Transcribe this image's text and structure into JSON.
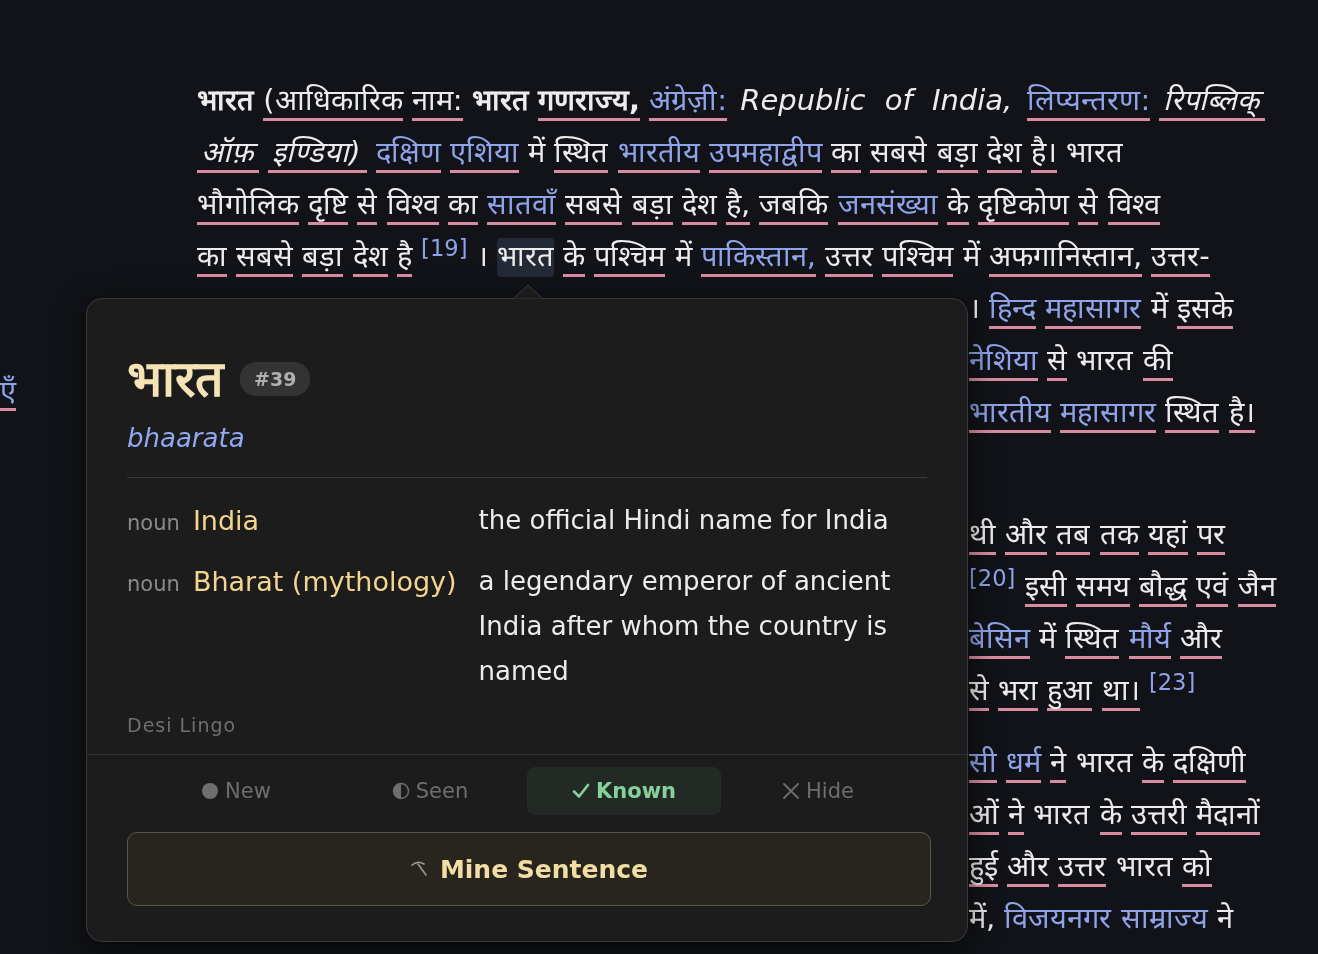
{
  "sidebar_fragment": {
    "text": "एँ",
    "underlined": true
  },
  "article": {
    "paragraphs": [
      {
        "lines": [
          {
            "covered_by_popup": false,
            "tokens": [
              {
                "text": "भारत",
                "kind": "bold",
                "underlined": false,
                "selected": false
              },
              {
                "text": "(आधिकारिक",
                "kind": "plain",
                "underlined": true,
                "selected": false
              },
              {
                "text": "नाम:",
                "kind": "plain",
                "underlined": true,
                "selected": false
              },
              {
                "text": "भारत",
                "kind": "bold",
                "underlined": false,
                "selected": false
              },
              {
                "text": "गणराज्य,",
                "kind": "bold",
                "underlined": true,
                "selected": false
              },
              {
                "text": "अंग्रेज़ी:",
                "kind": "link",
                "underlined": true,
                "selected": false
              },
              {
                "text": "Republic",
                "kind": "italic",
                "underlined": false,
                "selected": false
              },
              {
                "text": "of",
                "kind": "italic",
                "underlined": false,
                "selected": false
              },
              {
                "text": "India,",
                "kind": "italic",
                "underlined": false,
                "selected": false
              },
              {
                "text": "लिप्यन्तरण:",
                "kind": "link",
                "underlined": true,
                "selected": false
              },
              {
                "text": "रिपब्लिक्",
                "kind": "italic",
                "underlined": true,
                "selected": false
              }
            ]
          },
          {
            "covered_by_popup": false,
            "tokens": [
              {
                "text": "ऑफ़",
                "kind": "italic",
                "underlined": true,
                "selected": false
              },
              {
                "text": "इण्डिया)",
                "kind": "italic",
                "underlined": true,
                "selected": false
              },
              {
                "text": "दक्षिण",
                "kind": "link",
                "underlined": true,
                "selected": false
              },
              {
                "text": "एशिया",
                "kind": "link",
                "underlined": true,
                "selected": false
              },
              {
                "text": "में",
                "kind": "plain",
                "underlined": false,
                "selected": false
              },
              {
                "text": "स्थित",
                "kind": "plain",
                "underlined": true,
                "selected": false
              },
              {
                "text": "भारतीय",
                "kind": "link",
                "underlined": true,
                "selected": false
              },
              {
                "text": "उपमहाद्वीप",
                "kind": "link",
                "underlined": true,
                "selected": false
              },
              {
                "text": "का",
                "kind": "plain",
                "underlined": true,
                "selected": false
              },
              {
                "text": "सबसे",
                "kind": "plain",
                "underlined": true,
                "selected": false
              },
              {
                "text": "बड़ा",
                "kind": "plain",
                "underlined": true,
                "selected": false
              },
              {
                "text": "देश",
                "kind": "plain",
                "underlined": true,
                "selected": false
              },
              {
                "text": "है।",
                "kind": "plain",
                "underlined": true,
                "selected": false
              },
              {
                "text": "भारत",
                "kind": "plain",
                "underlined": false,
                "selected": false
              }
            ]
          },
          {
            "covered_by_popup": false,
            "tokens": [
              {
                "text": "भौगोलिक",
                "kind": "plain",
                "underlined": true,
                "selected": false
              },
              {
                "text": "दृष्टि",
                "kind": "plain",
                "underlined": true,
                "selected": false
              },
              {
                "text": "से",
                "kind": "plain",
                "underlined": true,
                "selected": false
              },
              {
                "text": "विश्व",
                "kind": "plain",
                "underlined": true,
                "selected": false
              },
              {
                "text": "का",
                "kind": "plain",
                "underlined": true,
                "selected": false
              },
              {
                "text": "सातवाँ",
                "kind": "link",
                "underlined": true,
                "selected": false
              },
              {
                "text": "सबसे",
                "kind": "plain",
                "underlined": true,
                "selected": false
              },
              {
                "text": "बड़ा",
                "kind": "plain",
                "underlined": true,
                "selected": false
              },
              {
                "text": "देश",
                "kind": "plain",
                "underlined": true,
                "selected": false
              },
              {
                "text": "है,",
                "kind": "plain",
                "underlined": true,
                "selected": false
              },
              {
                "text": "जबकि",
                "kind": "plain",
                "underlined": true,
                "selected": false
              },
              {
                "text": "जनसंख्या",
                "kind": "link",
                "underlined": true,
                "selected": false
              },
              {
                "text": "के",
                "kind": "plain",
                "underlined": true,
                "selected": false
              },
              {
                "text": "दृष्टिकोण",
                "kind": "plain",
                "underlined": true,
                "selected": false
              },
              {
                "text": "से",
                "kind": "plain",
                "underlined": true,
                "selected": false
              },
              {
                "text": "विश्व",
                "kind": "plain",
                "underlined": true,
                "selected": false
              }
            ]
          },
          {
            "covered_by_popup": false,
            "tokens": [
              {
                "text": "का",
                "kind": "plain",
                "underlined": true,
                "selected": false
              },
              {
                "text": "सबसे",
                "kind": "plain",
                "underlined": true,
                "selected": false
              },
              {
                "text": "बड़ा",
                "kind": "plain",
                "underlined": true,
                "selected": false
              },
              {
                "text": "देश",
                "kind": "plain",
                "underlined": true,
                "selected": false
              },
              {
                "text": "है",
                "kind": "plain",
                "underlined": true,
                "selected": false
              },
              {
                "text": "[19]",
                "kind": "ref",
                "underlined": false,
                "selected": false
              },
              {
                "text": "।",
                "kind": "punct",
                "underlined": false,
                "selected": false
              },
              {
                "text": "भारत",
                "kind": "plain",
                "underlined": false,
                "selected": true
              },
              {
                "text": "के",
                "kind": "plain",
                "underlined": true,
                "selected": false
              },
              {
                "text": "पश्चिम",
                "kind": "plain",
                "underlined": true,
                "selected": false
              },
              {
                "text": "में",
                "kind": "plain",
                "underlined": false,
                "selected": false
              },
              {
                "text": "पाकिस्तान,",
                "kind": "link",
                "underlined": true,
                "selected": false
              },
              {
                "text": "उत्तर",
                "kind": "plain",
                "underlined": true,
                "selected": false
              },
              {
                "text": "पश्चिम",
                "kind": "plain",
                "underlined": true,
                "selected": false
              },
              {
                "text": "में",
                "kind": "plain",
                "underlined": false,
                "selected": false
              },
              {
                "text": "अफगानिस्तान,",
                "kind": "plain",
                "underlined": true,
                "selected": false
              },
              {
                "text": "उत्तर-",
                "kind": "plain",
                "underlined": true,
                "selected": false
              }
            ]
          },
          {
            "covered_by_popup": true,
            "tokens": [
              {
                "text": "।",
                "kind": "punct",
                "underlined": false,
                "selected": false
              },
              {
                "text": "हिन्द",
                "kind": "link",
                "underlined": true,
                "selected": false
              },
              {
                "text": "महासागर",
                "kind": "link",
                "underlined": true,
                "selected": false
              },
              {
                "text": "में",
                "kind": "plain",
                "underlined": false,
                "selected": false
              },
              {
                "text": "इसके",
                "kind": "plain",
                "underlined": true,
                "selected": false
              }
            ]
          },
          {
            "covered_by_popup": true,
            "tokens": [
              {
                "text": "नेशिया",
                "kind": "link",
                "underlined": true,
                "selected": false
              },
              {
                "text": "से",
                "kind": "plain",
                "underlined": true,
                "selected": false
              },
              {
                "text": "भारत",
                "kind": "plain",
                "underlined": false,
                "selected": false
              },
              {
                "text": "की",
                "kind": "plain",
                "underlined": true,
                "selected": false
              }
            ]
          },
          {
            "covered_by_popup": true,
            "tokens": [
              {
                "text": "भारतीय",
                "kind": "link",
                "underlined": true,
                "selected": false
              },
              {
                "text": "महासागर",
                "kind": "link",
                "underlined": true,
                "selected": false
              },
              {
                "text": "स्थित",
                "kind": "plain",
                "underlined": true,
                "selected": false
              },
              {
                "text": "है।",
                "kind": "plain",
                "underlined": true,
                "selected": false
              }
            ]
          }
        ]
      },
      {
        "lines": [
          {
            "covered_by_popup": true,
            "tokens": [
              {
                "text": "थी",
                "kind": "plain",
                "underlined": true,
                "selected": false
              },
              {
                "text": "और",
                "kind": "plain",
                "underlined": true,
                "selected": false
              },
              {
                "text": "तब",
                "kind": "plain",
                "underlined": true,
                "selected": false
              },
              {
                "text": "तक",
                "kind": "plain",
                "underlined": true,
                "selected": false
              },
              {
                "text": "यहां",
                "kind": "plain",
                "underlined": true,
                "selected": false
              },
              {
                "text": "पर",
                "kind": "plain",
                "underlined": true,
                "selected": false
              }
            ]
          },
          {
            "covered_by_popup": true,
            "tokens": [
              {
                "text": "[20]",
                "kind": "ref",
                "underlined": false,
                "selected": false
              },
              {
                "text": "इसी",
                "kind": "plain",
                "underlined": true,
                "selected": false
              },
              {
                "text": "समय",
                "kind": "plain",
                "underlined": true,
                "selected": false
              },
              {
                "text": "बौद्ध",
                "kind": "plain",
                "underlined": true,
                "selected": false
              },
              {
                "text": "एवं",
                "kind": "plain",
                "underlined": true,
                "selected": false
              },
              {
                "text": "जैन",
                "kind": "plain",
                "underlined": true,
                "selected": false
              }
            ]
          },
          {
            "covered_by_popup": true,
            "tokens": [
              {
                "text": "बेसिन",
                "kind": "link",
                "underlined": true,
                "selected": false
              },
              {
                "text": "में",
                "kind": "plain",
                "underlined": false,
                "selected": false
              },
              {
                "text": "स्थित",
                "kind": "plain",
                "underlined": true,
                "selected": false
              },
              {
                "text": "मौर्य",
                "kind": "link",
                "underlined": true,
                "selected": false
              },
              {
                "text": "और",
                "kind": "plain",
                "underlined": true,
                "selected": false
              }
            ]
          },
          {
            "covered_by_popup": true,
            "tokens": [
              {
                "text": "से",
                "kind": "plain",
                "underlined": true,
                "selected": false
              },
              {
                "text": "भरा",
                "kind": "plain",
                "underlined": true,
                "selected": false
              },
              {
                "text": "हुआ",
                "kind": "plain",
                "underlined": true,
                "selected": false
              },
              {
                "text": "था।",
                "kind": "plain",
                "underlined": true,
                "selected": false
              },
              {
                "text": "[23]",
                "kind": "ref",
                "underlined": false,
                "selected": false
              }
            ]
          }
        ]
      },
      {
        "lines": [
          {
            "covered_by_popup": true,
            "tokens": [
              {
                "text": "सी",
                "kind": "link",
                "underlined": true,
                "selected": false
              },
              {
                "text": "धर्म",
                "kind": "link",
                "underlined": true,
                "selected": false
              },
              {
                "text": "ने",
                "kind": "plain",
                "underlined": true,
                "selected": false
              },
              {
                "text": "भारत",
                "kind": "plain",
                "underlined": false,
                "selected": false
              },
              {
                "text": "के",
                "kind": "plain",
                "underlined": true,
                "selected": false
              },
              {
                "text": "दक्षिणी",
                "kind": "plain",
                "underlined": true,
                "selected": false
              }
            ]
          },
          {
            "covered_by_popup": true,
            "tokens": [
              {
                "text": "ओं",
                "kind": "plain",
                "underlined": true,
                "selected": false
              },
              {
                "text": "ने",
                "kind": "plain",
                "underlined": true,
                "selected": false
              },
              {
                "text": "भारत",
                "kind": "plain",
                "underlined": false,
                "selected": false
              },
              {
                "text": "के",
                "kind": "plain",
                "underlined": true,
                "selected": false
              },
              {
                "text": "उत्तरी",
                "kind": "plain",
                "underlined": true,
                "selected": false
              },
              {
                "text": "मैदानों",
                "kind": "plain",
                "underlined": true,
                "selected": false
              }
            ]
          },
          {
            "covered_by_popup": true,
            "tokens": [
              {
                "text": "हुई",
                "kind": "plain",
                "underlined": true,
                "selected": false
              },
              {
                "text": "और",
                "kind": "plain",
                "underlined": true,
                "selected": false
              },
              {
                "text": "उत्तर",
                "kind": "plain",
                "underlined": true,
                "selected": false
              },
              {
                "text": "भारत",
                "kind": "plain",
                "underlined": false,
                "selected": false
              },
              {
                "text": "को",
                "kind": "plain",
                "underlined": true,
                "selected": false
              }
            ]
          },
          {
            "covered_by_popup": true,
            "tokens": [
              {
                "text": "में,",
                "kind": "plain",
                "underlined": false,
                "selected": false
              },
              {
                "text": "विजयनगर",
                "kind": "link",
                "underlined": false,
                "selected": false
              },
              {
                "text": "साम्राज्य",
                "kind": "link",
                "underlined": false,
                "selected": false
              },
              {
                "text": "ने",
                "kind": "plain",
                "underlined": false,
                "selected": false
              }
            ]
          }
        ]
      }
    ]
  },
  "popup": {
    "headword": "भारत",
    "rank": "#39",
    "transliteration": "bhaarata",
    "senses": [
      {
        "pos": "noun",
        "term": "India",
        "definition": "the official Hindi name for India"
      },
      {
        "pos": "noun",
        "term": "Bharat (mythology)",
        "definition": "a legendary emperor of ancient India after whom the country is named"
      }
    ],
    "source": "Desi Lingo",
    "statuses": [
      {
        "kind": "new",
        "label": "New",
        "selected": false
      },
      {
        "kind": "seen",
        "label": "Seen",
        "selected": false
      },
      {
        "kind": "known",
        "label": "Known",
        "selected": true
      },
      {
        "kind": "hide",
        "label": "Hide",
        "selected": false
      }
    ],
    "action": {
      "label": "Mine Sentence"
    }
  }
}
